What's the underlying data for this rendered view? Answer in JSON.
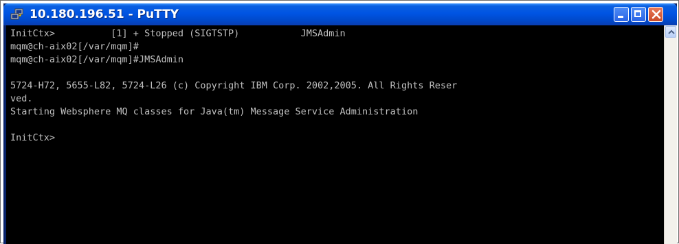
{
  "window": {
    "title": "10.180.196.51 - PuTTY",
    "icon": "putty-icon",
    "buttons": {
      "minimize_icon": "minimize-icon",
      "maximize_icon": "maximize-icon",
      "close_icon": "close-icon"
    }
  },
  "terminal": {
    "foreground": "#c0c0c0",
    "background": "#000000",
    "lines": [
      "InitCtx>          [1] + Stopped (SIGTSTP)           JMSAdmin",
      "mqm@ch-aix02[/var/mqm]#",
      "mqm@ch-aix02[/var/mqm]#JMSAdmin",
      "",
      "5724-H72, 5655-L82, 5724-L26 (c) Copyright IBM Corp. 2002,2005. All Rights Reser",
      "ved.",
      "Starting Websphere MQ classes for Java(tm) Message Service Administration",
      "",
      "InitCtx>"
    ]
  },
  "scrollbar": {
    "up_arrow_icon": "scroll-up-arrow-icon"
  }
}
